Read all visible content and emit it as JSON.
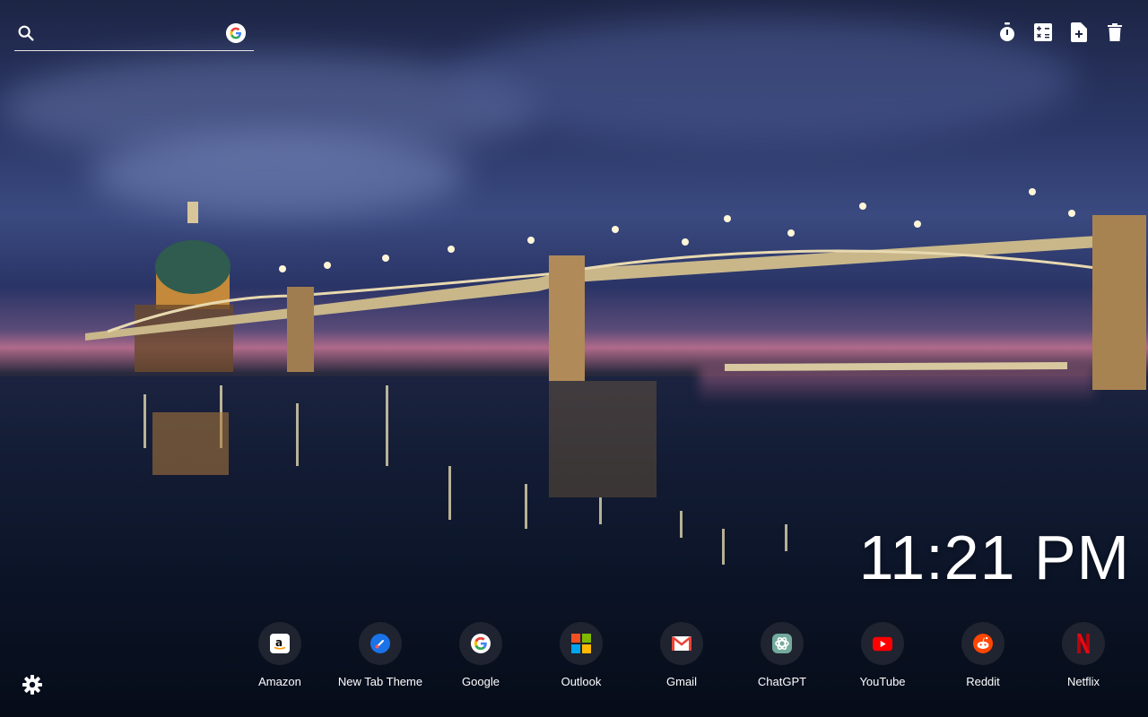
{
  "search": {
    "placeholder": "",
    "value": ""
  },
  "toolbar": {
    "icons": [
      "timer-icon",
      "calculator-icon",
      "add-note-icon",
      "trash-icon"
    ]
  },
  "clock": {
    "time": "11:21 PM"
  },
  "shortcuts": [
    {
      "label": "Amazon",
      "icon": "amazon-icon",
      "color": "#ffffff"
    },
    {
      "label": "New Tab Theme",
      "icon": "new-tab-theme-icon",
      "color": "#1a73e8"
    },
    {
      "label": "Google",
      "icon": "google-icon",
      "color": "#ffffff"
    },
    {
      "label": "Outlook",
      "icon": "microsoft-icon",
      "color": "#f25022"
    },
    {
      "label": "Gmail",
      "icon": "gmail-icon",
      "color": "#ea4335"
    },
    {
      "label": "ChatGPT",
      "icon": "chatgpt-icon",
      "color": "#74aa9c"
    },
    {
      "label": "YouTube",
      "icon": "youtube-icon",
      "color": "#ff0000"
    },
    {
      "label": "Reddit",
      "icon": "reddit-icon",
      "color": "#ff4500"
    },
    {
      "label": "Netflix",
      "icon": "netflix-icon",
      "color": "#e50914"
    }
  ],
  "settings": {
    "icon": "gear-icon"
  }
}
